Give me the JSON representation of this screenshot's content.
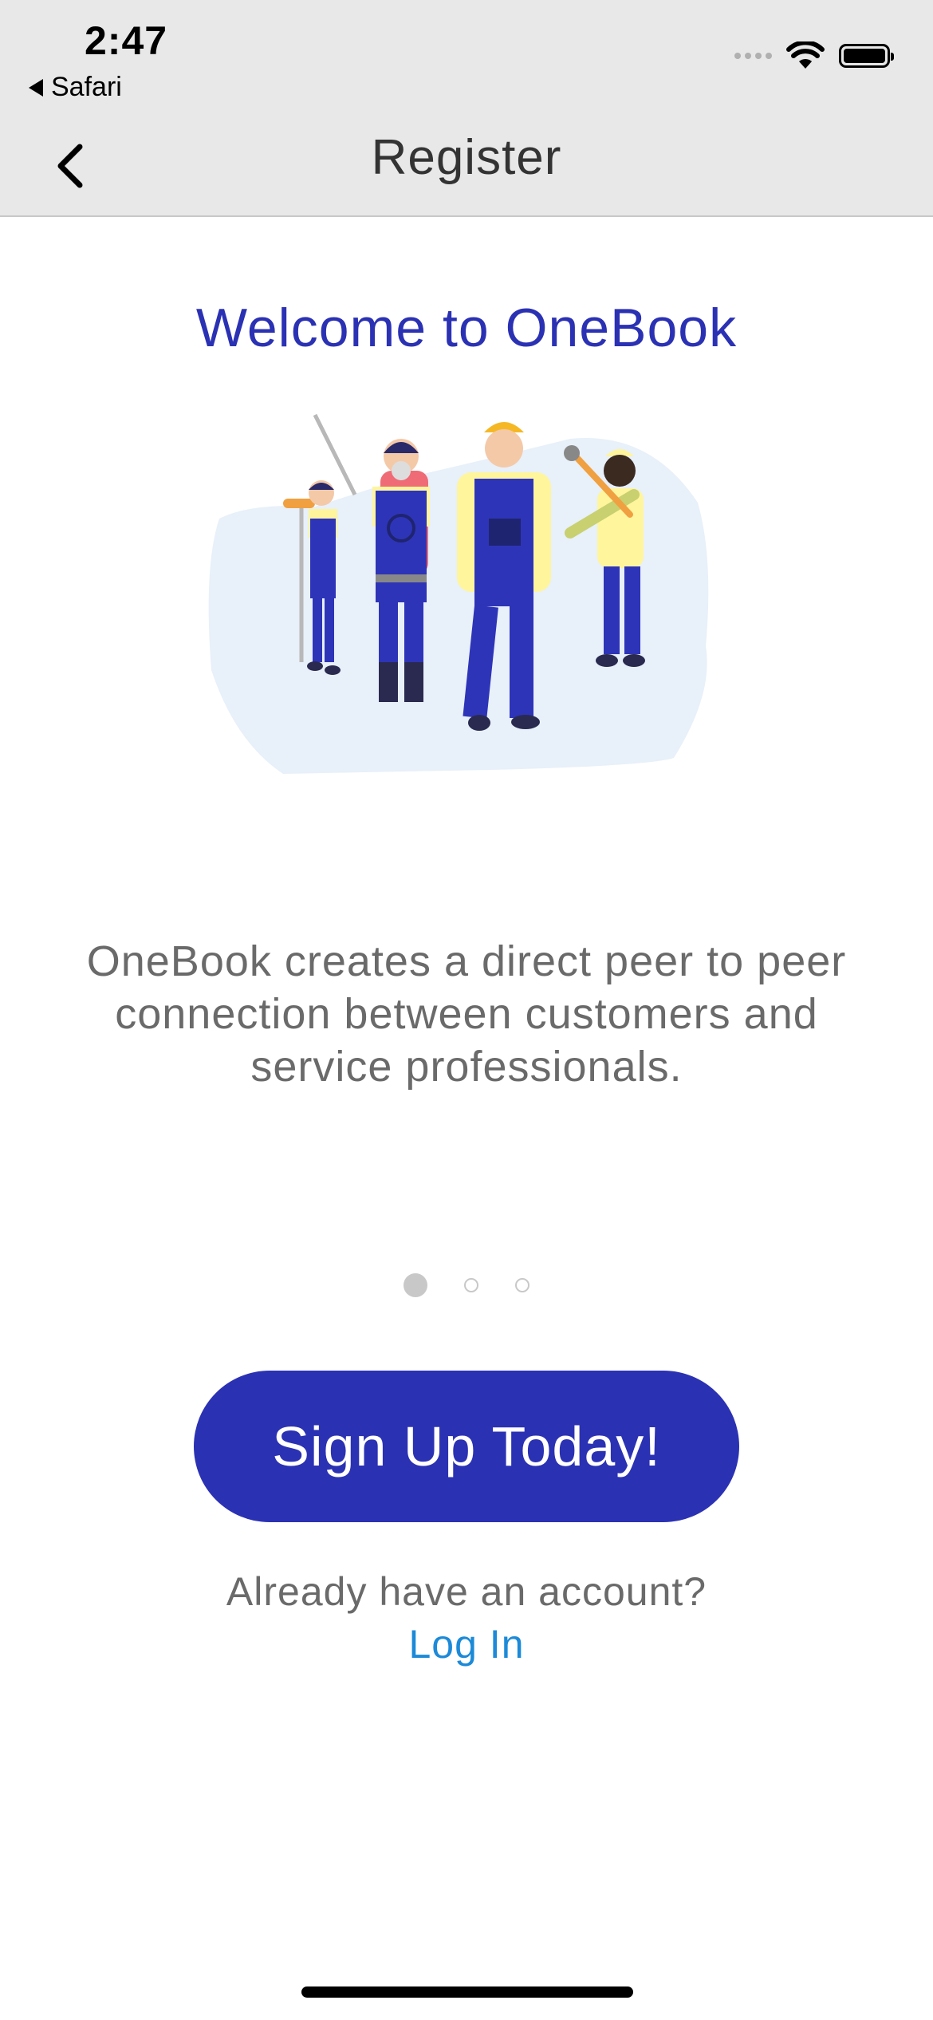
{
  "status_bar": {
    "time": "2:47",
    "back_app_label": "Safari"
  },
  "nav": {
    "title": "Register"
  },
  "welcome": {
    "heading": "Welcome to OneBook",
    "description": "OneBook creates a direct peer to peer connection between customers and service professionals."
  },
  "pager": {
    "page_count": 3,
    "active_index": 0
  },
  "actions": {
    "signup_label": "Sign Up Today!",
    "already_text": "Already have an account?",
    "login_label": "Log In"
  },
  "colors": {
    "brand": "#2b31b3",
    "link": "#1c8ad8",
    "body_text": "#6a6a6a"
  }
}
